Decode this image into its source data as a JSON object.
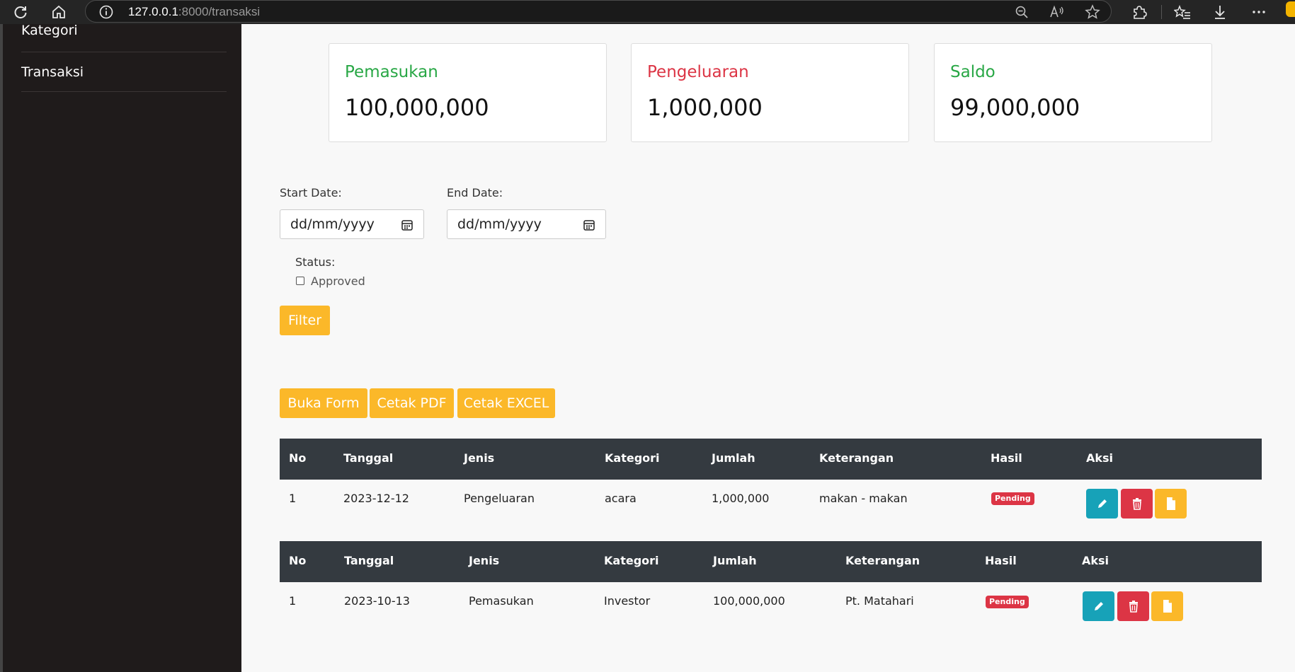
{
  "browser": {
    "url_host": "127.0.0.1",
    "url_path": ":8000/transaksi"
  },
  "sidebar": {
    "items": [
      {
        "label": "Kategori"
      },
      {
        "label": "Transaksi"
      }
    ]
  },
  "summary": {
    "cards": [
      {
        "title": "Pemasukan",
        "value": "100,000,000",
        "color": "#28a745"
      },
      {
        "title": "Pengeluaran",
        "value": "1,000,000",
        "color": "#dc3545"
      },
      {
        "title": "Saldo",
        "value": "99,000,000",
        "color": "#28a745"
      }
    ]
  },
  "filter": {
    "start_label": "Start Date:",
    "start_placeholder": "dd/mm/yyyy",
    "end_label": "End Date:",
    "end_placeholder": "dd/mm/yyyy",
    "status_label": "Status:",
    "approved_label": "Approved",
    "approved_checked": false,
    "filter_button": "Filter"
  },
  "actions": {
    "buka_form": "Buka Form",
    "cetak_pdf": "Cetak PDF",
    "cetak_excel": "Cetak EXCEL"
  },
  "tables": [
    {
      "headers": [
        "No",
        "Tanggal",
        "Jenis",
        "Kategori",
        "Jumlah",
        "Keterangan",
        "Hasil",
        "Aksi"
      ],
      "rows": [
        {
          "no": "1",
          "tanggal": "2023-12-12",
          "jenis": "Pengeluaran",
          "kategori": "acara",
          "jumlah": "1,000,000",
          "keterangan": "makan - makan",
          "hasil": "Pending"
        }
      ]
    },
    {
      "headers": [
        "No",
        "Tanggal",
        "Jenis",
        "Kategori",
        "Jumlah",
        "Keterangan",
        "Hasil",
        "Aksi"
      ],
      "rows": [
        {
          "no": "1",
          "tanggal": "2023-10-13",
          "jenis": "Pemasukan",
          "kategori": "Investor",
          "jumlah": "100,000,000",
          "keterangan": "Pt. Matahari",
          "hasil": "Pending"
        }
      ]
    }
  ],
  "colors": {
    "sidebar_bg": "#1f1b1b",
    "warning": "#fbb829",
    "info": "#17a2b8",
    "danger": "#dc3545",
    "table_header": "#343a40"
  },
  "icons": {
    "reload": "reload-icon",
    "home": "home-icon",
    "info": "info-icon",
    "zoom": "zoom-out-icon",
    "read_aloud": "read-aloud-icon",
    "favorite": "star-icon",
    "extensions": "extensions-icon",
    "favorites": "favorites-icon",
    "download": "download-icon",
    "more": "more-icon",
    "calendar": "calendar-icon",
    "edit": "pencil-icon",
    "delete": "trash-icon",
    "detail": "document-icon"
  }
}
